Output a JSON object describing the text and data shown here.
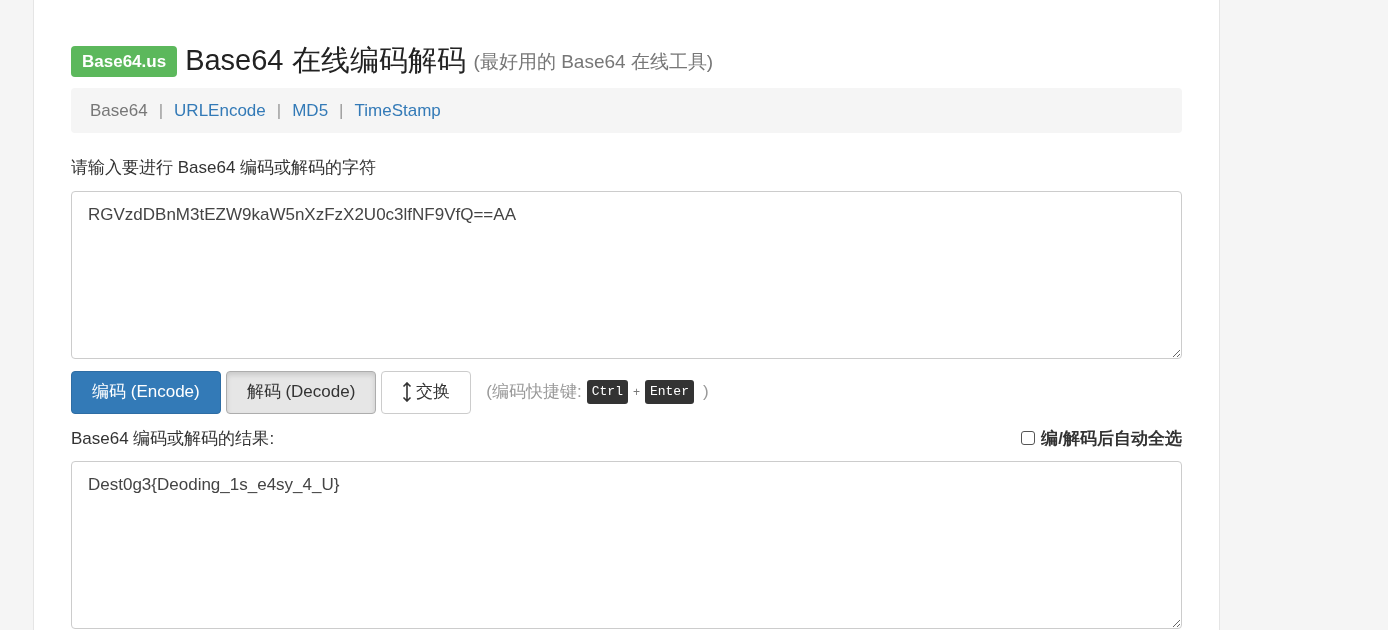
{
  "header": {
    "badge": "Base64.us",
    "title": "Base64 在线编码解码",
    "subtitle": "(最好用的 Base64 在线工具)"
  },
  "nav": [
    {
      "kind": "link",
      "label": "Base64",
      "selected": true
    },
    {
      "kind": "separator",
      "label": "|"
    },
    {
      "kind": "link",
      "label": "URLEncode",
      "selected": false
    },
    {
      "kind": "separator",
      "label": "|"
    },
    {
      "kind": "link",
      "label": "MD5",
      "selected": false
    },
    {
      "kind": "separator",
      "label": "|"
    },
    {
      "kind": "link",
      "label": "TimeStamp",
      "selected": false
    }
  ],
  "input": {
    "label": "请输入要进行 Base64 编码或解码的字符",
    "value": "RGVzdDBnM3tEZW9kaW5nXzFzX2U0c3lfNF9VfQ==AA"
  },
  "buttons": [
    {
      "kind": "primary",
      "label": "编码 (Encode)",
      "pressed": false
    },
    {
      "kind": "default",
      "label": "解码 (Decode)",
      "pressed": true
    },
    {
      "kind": "swap",
      "label": "交换",
      "pressed": false
    }
  ],
  "shortcut": {
    "prefix": "(编码快捷键:",
    "keys": [
      "Ctrl",
      "Enter"
    ],
    "joiner": "+",
    "suffix": ")"
  },
  "output": {
    "label": "Base64 编码或解码的结果:",
    "auto_select": {
      "label": "编/解码后自动全选",
      "checked": false
    },
    "value": "Dest0g3{Deoding_1s_e4sy_4_U}"
  }
}
